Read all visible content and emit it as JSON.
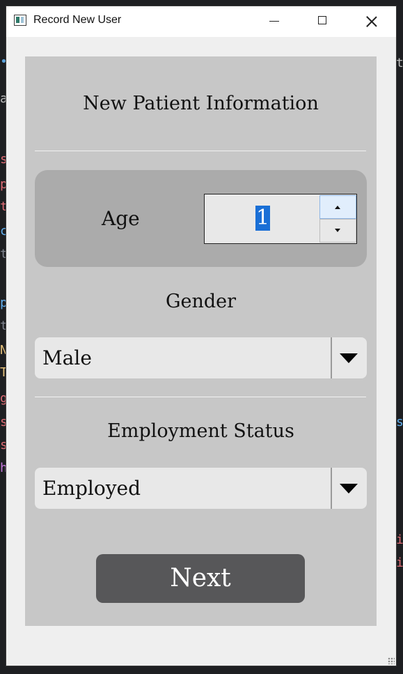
{
  "window": {
    "title": "Record New User"
  },
  "titlebar": {
    "minimize_icon": "minimize-icon",
    "maximize_icon": "maximize-icon",
    "close_icon": "close-icon"
  },
  "form": {
    "title": "New Patient Information",
    "age": {
      "label": "Age",
      "value": "1"
    },
    "gender": {
      "label": "Gender",
      "selected": "Male"
    },
    "employment": {
      "label": "Employment Status",
      "selected": "Employed"
    },
    "next_label": "Next"
  },
  "colors": {
    "panel": "#c7c7c7",
    "age_box": "#ababab",
    "button": "#575759",
    "selection": "#1a6fd6"
  }
}
